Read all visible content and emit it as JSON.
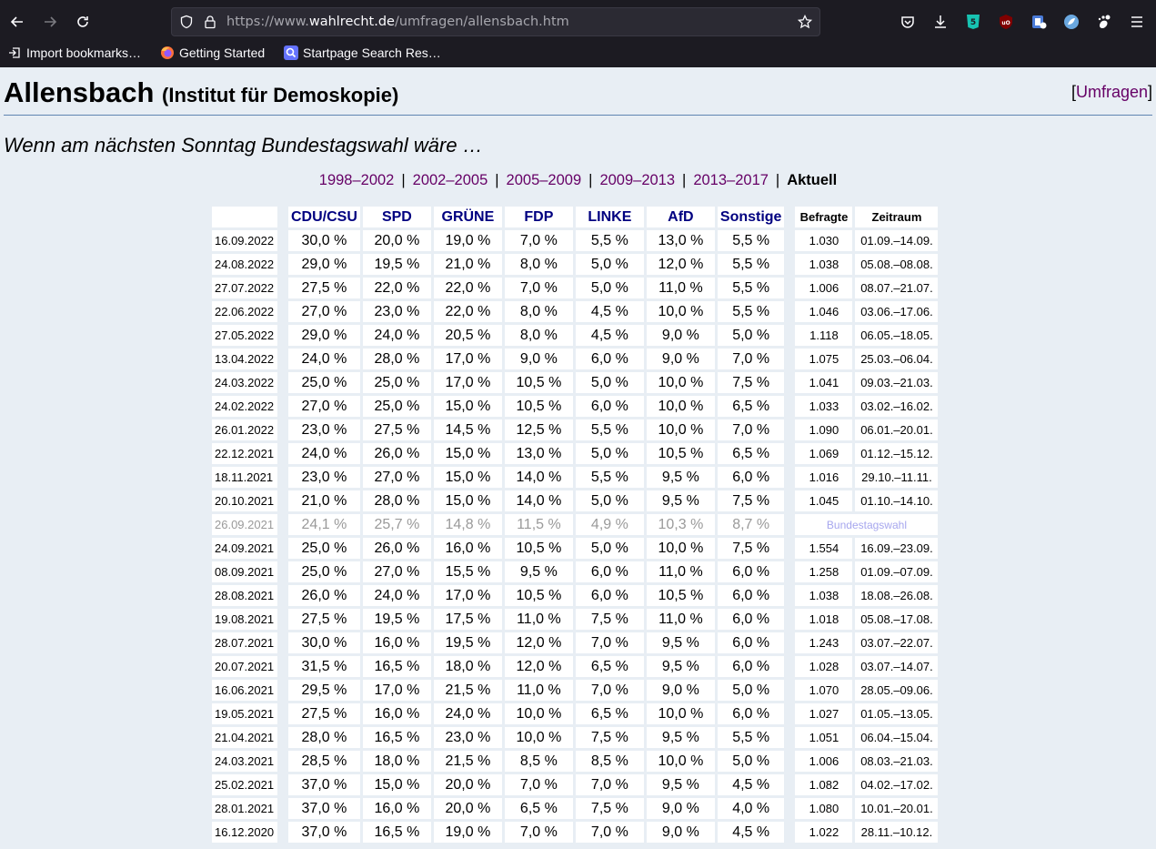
{
  "browser": {
    "url_prefix": "https://www.",
    "url_domain": "wahlrecht.de",
    "url_path": "/umfragen/allensbach.htm",
    "bookmarks": [
      {
        "label": "Import bookmarks…",
        "icon": "import-icon"
      },
      {
        "label": "Getting Started",
        "icon": "firefox-icon"
      },
      {
        "label": "Startpage Search Res…",
        "icon": "startpage-icon"
      }
    ]
  },
  "header": {
    "title": "Allensbach",
    "subtitle": "(Institut für Demoskopie)",
    "umfragen_open": "[",
    "umfragen_link": "Umfragen",
    "umfragen_close": "]"
  },
  "question": "Wenn am nächsten Sonntag Bundestagswahl wäre …",
  "periods": {
    "links": [
      "1998–2002",
      "2002–2005",
      "2005–2009",
      "2009–2013",
      "2013–2017"
    ],
    "current": "Aktuell"
  },
  "table": {
    "parties": [
      "CDU/CSU",
      "SPD",
      "GRÜNE",
      "FDP",
      "LINKE",
      "AfD",
      "Sonstige"
    ],
    "col_befragte": "Befragte",
    "col_zeitraum": "Zeitraum",
    "rows": [
      {
        "date": "16.09.2022",
        "v": [
          "30,0 %",
          "20,0 %",
          "19,0 %",
          "7,0 %",
          "5,5 %",
          "13,0 %",
          "5,5 %"
        ],
        "n": "1.030",
        "period": "01.09.–14.09."
      },
      {
        "date": "24.08.2022",
        "v": [
          "29,0 %",
          "19,5 %",
          "21,0 %",
          "8,0 %",
          "5,0 %",
          "12,0 %",
          "5,5 %"
        ],
        "n": "1.038",
        "period": "05.08.–08.08."
      },
      {
        "date": "27.07.2022",
        "v": [
          "27,5 %",
          "22,0 %",
          "22,0 %",
          "7,0 %",
          "5,0 %",
          "11,0 %",
          "5,5 %"
        ],
        "n": "1.006",
        "period": "08.07.–21.07."
      },
      {
        "date": "22.06.2022",
        "v": [
          "27,0 %",
          "23,0 %",
          "22,0 %",
          "8,0 %",
          "4,5 %",
          "10,0 %",
          "5,5 %"
        ],
        "n": "1.046",
        "period": "03.06.–17.06."
      },
      {
        "date": "27.05.2022",
        "v": [
          "29,0 %",
          "24,0 %",
          "20,5 %",
          "8,0 %",
          "4,5 %",
          "9,0 %",
          "5,0 %"
        ],
        "n": "1.118",
        "period": "06.05.–18.05."
      },
      {
        "date": "13.04.2022",
        "v": [
          "24,0 %",
          "28,0 %",
          "17,0 %",
          "9,0 %",
          "6,0 %",
          "9,0 %",
          "7,0 %"
        ],
        "n": "1.075",
        "period": "25.03.–06.04."
      },
      {
        "date": "24.03.2022",
        "v": [
          "25,0 %",
          "25,0 %",
          "17,0 %",
          "10,5 %",
          "5,0 %",
          "10,0 %",
          "7,5 %"
        ],
        "n": "1.041",
        "period": "09.03.–21.03."
      },
      {
        "date": "24.02.2022",
        "v": [
          "27,0 %",
          "25,0 %",
          "15,0 %",
          "10,5 %",
          "6,0 %",
          "10,0 %",
          "6,5 %"
        ],
        "n": "1.033",
        "period": "03.02.–16.02."
      },
      {
        "date": "26.01.2022",
        "v": [
          "23,0 %",
          "27,5 %",
          "14,5 %",
          "12,5 %",
          "5,5 %",
          "10,0 %",
          "7,0 %"
        ],
        "n": "1.090",
        "period": "06.01.–20.01."
      },
      {
        "date": "22.12.2021",
        "v": [
          "24,0 %",
          "26,0 %",
          "15,0 %",
          "13,0 %",
          "5,0 %",
          "10,5 %",
          "6,5 %"
        ],
        "n": "1.069",
        "period": "01.12.–15.12."
      },
      {
        "date": "18.11.2021",
        "v": [
          "23,0 %",
          "27,0 %",
          "15,0 %",
          "14,0 %",
          "5,5 %",
          "9,5 %",
          "6,0 %"
        ],
        "n": "1.016",
        "period": "29.10.–11.11."
      },
      {
        "date": "20.10.2021",
        "v": [
          "21,0 %",
          "28,0 %",
          "15,0 %",
          "14,0 %",
          "5,0 %",
          "9,5 %",
          "7,5 %"
        ],
        "n": "1.045",
        "period": "01.10.–14.10."
      },
      {
        "date": "26.09.2021",
        "v": [
          "24,1 %",
          "25,7 %",
          "14,8 %",
          "11,5 %",
          "4,9 %",
          "10,3 %",
          "8,7 %"
        ],
        "election": "Bundestagswahl"
      },
      {
        "date": "24.09.2021",
        "v": [
          "25,0 %",
          "26,0 %",
          "16,0 %",
          "10,5 %",
          "5,0 %",
          "10,0 %",
          "7,5 %"
        ],
        "n": "1.554",
        "period": "16.09.–23.09."
      },
      {
        "date": "08.09.2021",
        "v": [
          "25,0 %",
          "27,0 %",
          "15,5 %",
          "9,5 %",
          "6,0 %",
          "11,0 %",
          "6,0 %"
        ],
        "n": "1.258",
        "period": "01.09.–07.09."
      },
      {
        "date": "28.08.2021",
        "v": [
          "26,0 %",
          "24,0 %",
          "17,0 %",
          "10,5 %",
          "6,0 %",
          "10,5 %",
          "6,0 %"
        ],
        "n": "1.038",
        "period": "18.08.–26.08."
      },
      {
        "date": "19.08.2021",
        "v": [
          "27,5 %",
          "19,5 %",
          "17,5 %",
          "11,0 %",
          "7,5 %",
          "11,0 %",
          "6,0 %"
        ],
        "n": "1.018",
        "period": "05.08.–17.08."
      },
      {
        "date": "28.07.2021",
        "v": [
          "30,0 %",
          "16,0 %",
          "19,5 %",
          "12,0 %",
          "7,0 %",
          "9,5 %",
          "6,0 %"
        ],
        "n": "1.243",
        "period": "03.07.–22.07."
      },
      {
        "date": "20.07.2021",
        "v": [
          "31,5 %",
          "16,5 %",
          "18,0 %",
          "12,0 %",
          "6,5 %",
          "9,5 %",
          "6,0 %"
        ],
        "n": "1.028",
        "period": "03.07.–14.07."
      },
      {
        "date": "16.06.2021",
        "v": [
          "29,5 %",
          "17,0 %",
          "21,5 %",
          "11,0 %",
          "7,0 %",
          "9,0 %",
          "5,0 %"
        ],
        "n": "1.070",
        "period": "28.05.–09.06."
      },
      {
        "date": "19.05.2021",
        "v": [
          "27,5 %",
          "16,0 %",
          "24,0 %",
          "10,0 %",
          "6,5 %",
          "10,0 %",
          "6,0 %"
        ],
        "n": "1.027",
        "period": "01.05.–13.05."
      },
      {
        "date": "21.04.2021",
        "v": [
          "28,0 %",
          "16,5 %",
          "23,0 %",
          "10,0 %",
          "7,5 %",
          "9,5 %",
          "5,5 %"
        ],
        "n": "1.051",
        "period": "06.04.–15.04."
      },
      {
        "date": "24.03.2021",
        "v": [
          "28,5 %",
          "18,0 %",
          "21,5 %",
          "8,5 %",
          "8,5 %",
          "10,0 %",
          "5,0 %"
        ],
        "n": "1.006",
        "period": "08.03.–21.03."
      },
      {
        "date": "25.02.2021",
        "v": [
          "37,0 %",
          "15,0 %",
          "20,0 %",
          "7,0 %",
          "7,0 %",
          "9,5 %",
          "4,5 %"
        ],
        "n": "1.082",
        "period": "04.02.–17.02."
      },
      {
        "date": "28.01.2021",
        "v": [
          "37,0 %",
          "16,0 %",
          "20,0 %",
          "6,5 %",
          "7,5 %",
          "9,0 %",
          "4,0 %"
        ],
        "n": "1.080",
        "period": "10.01.–20.01."
      },
      {
        "date": "16.12.2020",
        "v": [
          "37,0 %",
          "16,5 %",
          "19,0 %",
          "7,0 %",
          "7,0 %",
          "9,0 %",
          "4,5 %"
        ],
        "n": "1.022",
        "period": "28.11.–10.12."
      }
    ]
  }
}
